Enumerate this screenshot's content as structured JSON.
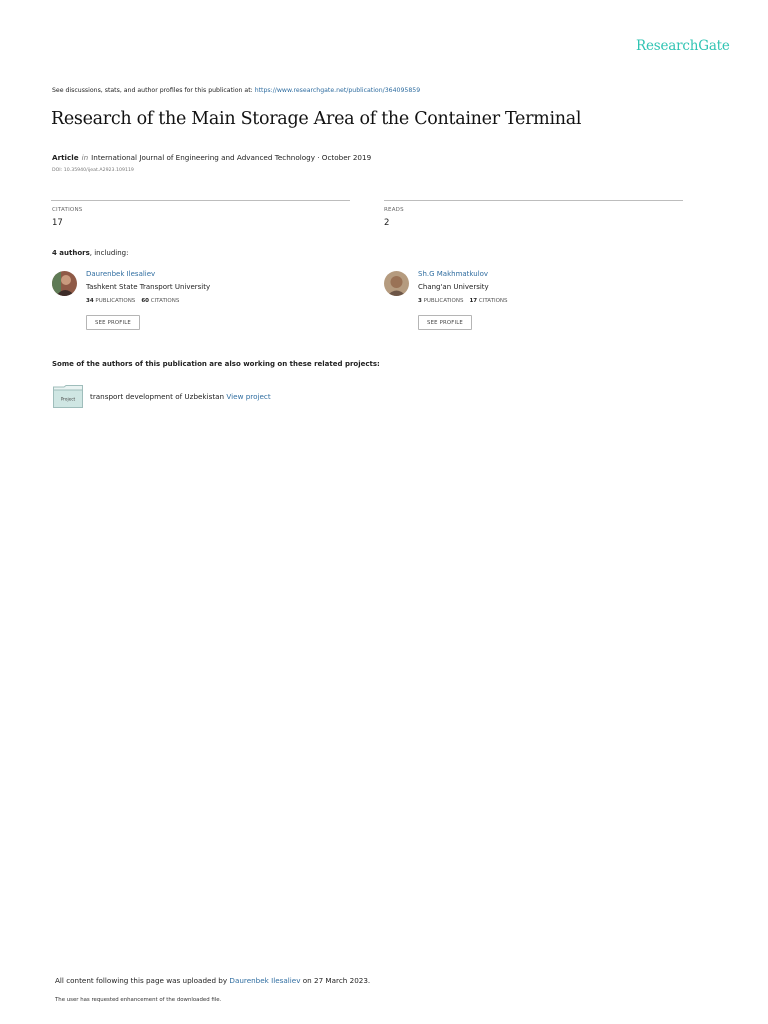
{
  "brand": {
    "logo_text": "ResearchGate",
    "accent_color": "#30c4b3",
    "link_color": "#2f6da0"
  },
  "top_note": {
    "prefix": "See discussions, stats, and author profiles for this publication at: ",
    "url": "https://www.researchgate.net/publication/364095859"
  },
  "publication": {
    "title": "Research of the Main Storage Area of the Container Terminal",
    "type": "Article",
    "in_word": "in",
    "journal": "International Journal of Engineering and Advanced Technology · October 2019",
    "doi": "DOI: 10.35940/ijeat.A2923.109119"
  },
  "stats": {
    "citations_label": "CITATIONS",
    "citations_value": "17",
    "reads_label": "READS",
    "reads_value": "2"
  },
  "authors_heading": {
    "count": "4 authors",
    "suffix": ", including:"
  },
  "authors": [
    {
      "name": "Daurenbek Ilesaliev",
      "institution": "Tashkent State Transport University",
      "publications": "34",
      "publications_label": "PUBLICATIONS",
      "citations": "60",
      "citations_label": "CITATIONS",
      "button": "SEE PROFILE"
    },
    {
      "name": "Sh.G Makhmatkulov",
      "institution": "Chang'an University",
      "publications": "3",
      "publications_label": "PUBLICATIONS",
      "citations": "17",
      "citations_label": "CITATIONS",
      "button": "SEE PROFILE"
    }
  ],
  "projects": {
    "heading": "Some of the authors of this publication are also working on these related projects:",
    "icon_label": "Project",
    "items": [
      {
        "title": "transport development of Uzbekistan",
        "link": "View project"
      }
    ]
  },
  "footer": {
    "uploaded_prefix": "All content following this page was uploaded by ",
    "uploader": "Daurenbek Ilesaliev",
    "uploaded_suffix": " on 27 March 2023.",
    "note": "The user has requested enhancement of the downloaded file."
  }
}
